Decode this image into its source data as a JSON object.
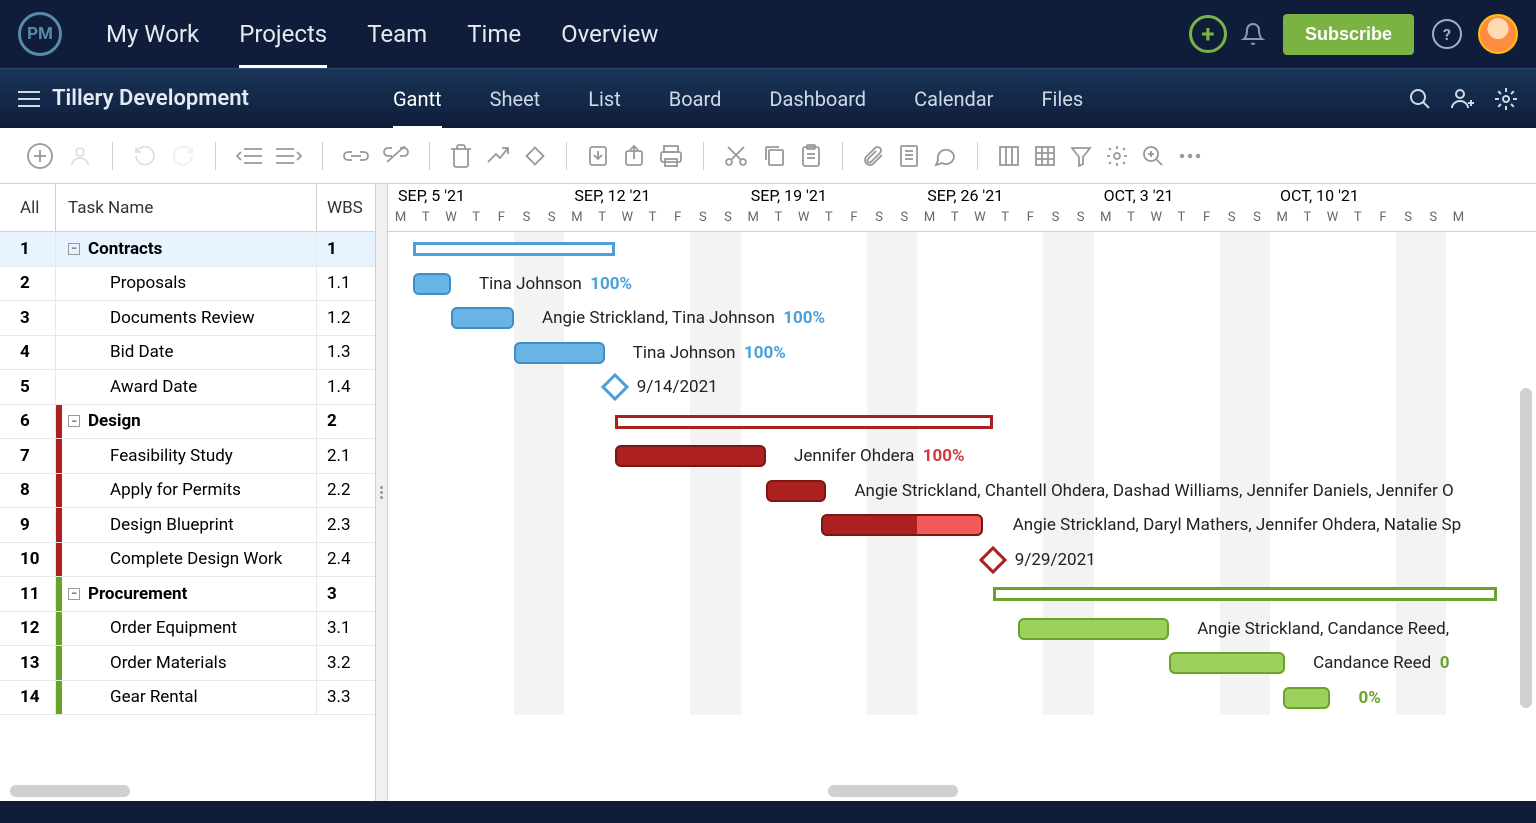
{
  "topnav": {
    "logo": "PM",
    "items": [
      "My Work",
      "Projects",
      "Team",
      "Time",
      "Overview"
    ],
    "active": 1,
    "subscribe": "Subscribe"
  },
  "subnav": {
    "project": "Tillery Development",
    "items": [
      "Gantt",
      "Sheet",
      "List",
      "Board",
      "Dashboard",
      "Calendar",
      "Files"
    ],
    "active": 0
  },
  "grid": {
    "headers": {
      "all": "All",
      "name": "Task Name",
      "wbs": "WBS"
    },
    "rows": [
      {
        "num": "1",
        "name": "Contracts",
        "wbs": "1",
        "summary": true,
        "sel": true,
        "color": null
      },
      {
        "num": "2",
        "name": "Proposals",
        "wbs": "1.1",
        "summary": false
      },
      {
        "num": "3",
        "name": "Documents Review",
        "wbs": "1.2",
        "summary": false
      },
      {
        "num": "4",
        "name": "Bid Date",
        "wbs": "1.3",
        "summary": false
      },
      {
        "num": "5",
        "name": "Award Date",
        "wbs": "1.4",
        "summary": false
      },
      {
        "num": "6",
        "name": "Design",
        "wbs": "2",
        "summary": true,
        "color": "#ac2020"
      },
      {
        "num": "7",
        "name": "Feasibility Study",
        "wbs": "2.1",
        "summary": false,
        "color": "#ac2020"
      },
      {
        "num": "8",
        "name": "Apply for Permits",
        "wbs": "2.2",
        "summary": false,
        "color": "#ac2020"
      },
      {
        "num": "9",
        "name": "Design Blueprint",
        "wbs": "2.3",
        "summary": false,
        "color": "#ac2020"
      },
      {
        "num": "10",
        "name": "Complete Design Work",
        "wbs": "2.4",
        "summary": false,
        "color": "#ac2020"
      },
      {
        "num": "11",
        "name": "Procurement",
        "wbs": "3",
        "summary": true,
        "color": "#6aa329"
      },
      {
        "num": "12",
        "name": "Order Equipment",
        "wbs": "3.1",
        "summary": false,
        "color": "#6aa329"
      },
      {
        "num": "13",
        "name": "Order Materials",
        "wbs": "3.2",
        "summary": false,
        "color": "#6aa329"
      },
      {
        "num": "14",
        "name": "Gear Rental",
        "wbs": "3.3",
        "summary": false,
        "color": "#6aa329"
      }
    ]
  },
  "timeline": {
    "day_width": 25.2,
    "start_offset_days": 0,
    "weeks": [
      {
        "label": "SEP, 5 '21",
        "col": 0
      },
      {
        "label": "SEP, 12 '21",
        "col": 7
      },
      {
        "label": "SEP, 19 '21",
        "col": 14
      },
      {
        "label": "SEP, 26 '21",
        "col": 21
      },
      {
        "label": "OCT, 3 '21",
        "col": 28
      },
      {
        "label": "OCT, 10 '21",
        "col": 35
      }
    ],
    "day_pattern": [
      "M",
      "T",
      "W",
      "T",
      "F",
      "S",
      "S"
    ]
  },
  "bars": [
    {
      "row": 0,
      "type": "summary",
      "start": 1,
      "end": 9,
      "color": "#4ca0d9"
    },
    {
      "row": 1,
      "type": "task",
      "start": 1,
      "end": 2.5,
      "fill": "#68b4e4",
      "border": "#3e8fc4",
      "label": "Tina Johnson",
      "pct": "100%",
      "pctColor": "#4ca0d9"
    },
    {
      "row": 2,
      "type": "task",
      "start": 2.5,
      "end": 5,
      "fill": "#68b4e4",
      "border": "#3e8fc4",
      "label": "Angie Strickland, Tina Johnson",
      "pct": "100%",
      "pctColor": "#4ca0d9"
    },
    {
      "row": 3,
      "type": "task",
      "start": 5,
      "end": 8.6,
      "fill": "#68b4e4",
      "border": "#3e8fc4",
      "label": "Tina Johnson",
      "pct": "100%",
      "pctColor": "#4ca0d9"
    },
    {
      "row": 4,
      "type": "milestone",
      "at": 9,
      "color": "#4ca0d9",
      "label": "9/14/2021"
    },
    {
      "row": 5,
      "type": "summary",
      "start": 9,
      "end": 24,
      "color": "#ac2020"
    },
    {
      "row": 6,
      "type": "task",
      "start": 9,
      "end": 15,
      "fill": "#ac2020",
      "border": "#7a1616",
      "label": "Jennifer Ohdera",
      "pct": "100%",
      "pctColor": "#d13a3a"
    },
    {
      "row": 7,
      "type": "task",
      "start": 15,
      "end": 17.4,
      "fill": "#ac2020",
      "border": "#7a1616",
      "label": "Angie Strickland, Chantell Ohdera, Dashad Williams, Jennifer Daniels, Jennifer O"
    },
    {
      "row": 8,
      "type": "task-partial",
      "start": 17.2,
      "end": 23.6,
      "split": 21,
      "fill1": "#ac2020",
      "fill2": "#f25a5a",
      "border": "#7a1616",
      "label": "Angie Strickland, Daryl Mathers, Jennifer Ohdera, Natalie Sp"
    },
    {
      "row": 9,
      "type": "milestone",
      "at": 24,
      "color": "#ac2020",
      "label": "9/29/2021"
    },
    {
      "row": 10,
      "type": "summary",
      "start": 24,
      "end": 44,
      "color": "#6aa329"
    },
    {
      "row": 11,
      "type": "task",
      "start": 25,
      "end": 31,
      "fill": "#9dd15e",
      "border": "#6aa329",
      "label": "Angie Strickland, Candance Reed,"
    },
    {
      "row": 12,
      "type": "task",
      "start": 31,
      "end": 35.6,
      "fill": "#9dd15e",
      "border": "#6aa329",
      "label": "Candance Reed",
      "pct": "0",
      "pctColor": "#6aa329"
    },
    {
      "row": 13,
      "type": "task",
      "start": 35.5,
      "end": 37.4,
      "fill": "#9dd15e",
      "border": "#6aa329",
      "label": "0%",
      "pctOnly": true,
      "pctColor": "#6aa329"
    }
  ]
}
